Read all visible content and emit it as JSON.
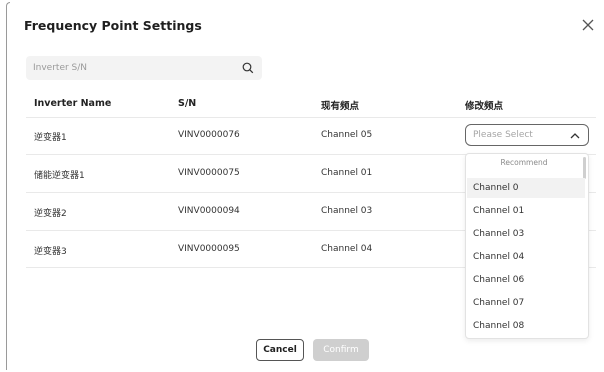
{
  "dialog": {
    "title": "Frequency Point Settings"
  },
  "search": {
    "placeholder": "Inverter S/N"
  },
  "table": {
    "headers": [
      "Inverter Name",
      "S/N",
      "现有频点",
      "修改频点"
    ],
    "rows": [
      {
        "name": "逆变器1",
        "sn": "VINV0000076",
        "channel": "Channel 05"
      },
      {
        "name": "储能逆变器1",
        "sn": "VINV0000075",
        "channel": "Channel 01"
      },
      {
        "name": "逆变器2",
        "sn": "VINV0000094",
        "channel": "Channel 03"
      },
      {
        "name": "逆变器3",
        "sn": "VINV0000095",
        "channel": "Channel 04"
      }
    ]
  },
  "select": {
    "placeholder": "Please Select"
  },
  "dropdown": {
    "group_label": "Recommend",
    "options": [
      "Channel 0",
      "Channel 01",
      "Channel 03",
      "Channel 04",
      "Channel 06",
      "Channel 07",
      "Channel 08"
    ]
  },
  "footer": {
    "cancel_label": "Cancel",
    "confirm_label": "Confirm"
  },
  "colors": {
    "confirm_disabled": "#cfcfcf",
    "search_bg": "#f3f3f3"
  }
}
